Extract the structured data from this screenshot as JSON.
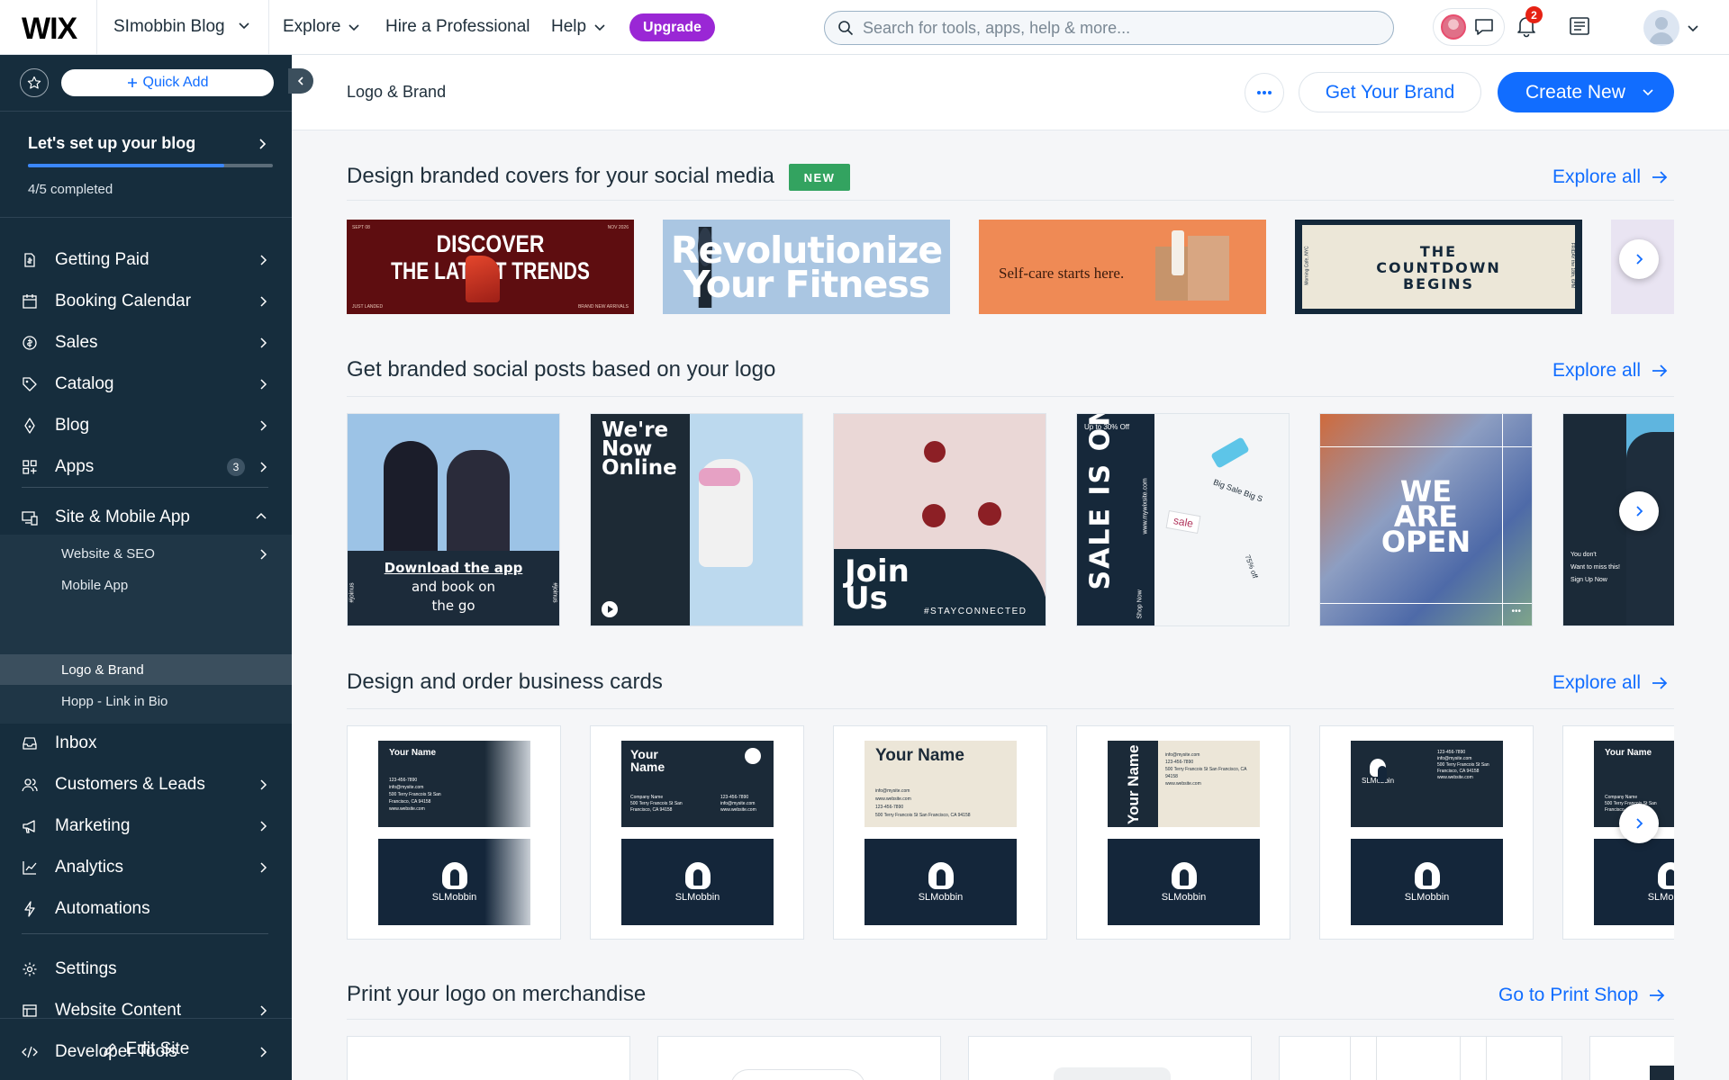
{
  "topbar": {
    "logo": "WIX",
    "site_name": "SImobbin Blog",
    "nav": {
      "explore": "Explore",
      "hire": "Hire a Professional",
      "help": "Help",
      "upgrade": "Upgrade"
    },
    "search_placeholder": "Search for tools, apps, help & more...",
    "notifications_count": "2"
  },
  "sidebar": {
    "quick_add": "Quick Add",
    "setup": {
      "title": "Let's set up your blog",
      "progress_text": "4/5 completed",
      "progress_fraction": 0.8
    },
    "items": [
      {
        "label": "Getting Paid"
      },
      {
        "label": "Booking Calendar"
      },
      {
        "label": "Sales"
      },
      {
        "label": "Catalog"
      },
      {
        "label": "Blog"
      },
      {
        "label": "Apps",
        "badge": "3"
      }
    ],
    "site_app": {
      "label": "Site & Mobile App",
      "children": [
        {
          "label": "Website & SEO"
        },
        {
          "label": "Mobile App"
        },
        {
          "label": "Logo & Brand"
        },
        {
          "label": "Hopp - Link in Bio"
        }
      ]
    },
    "items2": [
      {
        "label": "Inbox"
      },
      {
        "label": "Customers & Leads"
      },
      {
        "label": "Marketing"
      },
      {
        "label": "Analytics"
      },
      {
        "label": "Automations"
      }
    ],
    "items3": [
      {
        "label": "Settings"
      },
      {
        "label": "Website Content"
      },
      {
        "label": "Developer Tools"
      }
    ],
    "edit_site": "Edit Site"
  },
  "header": {
    "title": "Logo & Brand",
    "get_brand": "Get Your Brand",
    "create_new": "Create New"
  },
  "sections": {
    "covers": {
      "title": "Design branded covers for your social media",
      "tag": "NEW",
      "link": "Explore all",
      "cards": [
        {
          "line1": "DISCOVER",
          "line2": "THE LATEST TRENDS",
          "corner_tl": "SEPT 08",
          "corner_tr": "NOV 2026",
          "corner_bl": "JUST LANDED",
          "corner_br": "BRAND NEW ARRIVALS"
        },
        {
          "line1": "Revolutionize",
          "line2": "Your Fitness"
        },
        {
          "line1": "Self-care starts here."
        },
        {
          "line1": "THE",
          "line2": "COUNTDOWN",
          "line3": "BEGINS",
          "left_side": "Morning Cafe, NYC",
          "right_side": "FRIDAY the 18th, 6PM"
        }
      ]
    },
    "posts": {
      "title": "Get branded social posts based on your logo",
      "link": "Explore all",
      "cards": [
        {
          "line1": "Download the app",
          "line2": "and book on",
          "line3": "the go",
          "side_left": "#joinus",
          "side_right": "#joinus"
        },
        {
          "line1": "We're",
          "line2": "Now",
          "line3": "Online"
        },
        {
          "line1": "Join",
          "line2": "Us",
          "tag": "#STAYCONNECTED"
        },
        {
          "line1": "SALE IS ON",
          "top": "Up to 30% Off",
          "side": "www.mywixsite.com",
          "bottom": "Shop Now",
          "tag1": "sale",
          "tag2": "Big Sale Big S",
          "tag3": "75% off"
        },
        {
          "line1": "WE",
          "line2": "ARE",
          "line3": "OPEN",
          "dots": "•••"
        },
        {
          "line1": "You don't",
          "line2": "Want to miss this!",
          "line3": "Sign Up Now"
        }
      ]
    },
    "cards": {
      "title": "Design and order business cards",
      "link": "Explore all",
      "brand": "SLMobbin",
      "name": "Your Name",
      "email": "info@mysite.com",
      "phone": "123-456-7890",
      "address": "500 Terry Francois St San Francisco, CA 94158",
      "web": "www.website.com",
      "company": "Company Name"
    },
    "merch": {
      "title": "Print your logo on merchandise",
      "link": "Go to Print Shop"
    }
  }
}
